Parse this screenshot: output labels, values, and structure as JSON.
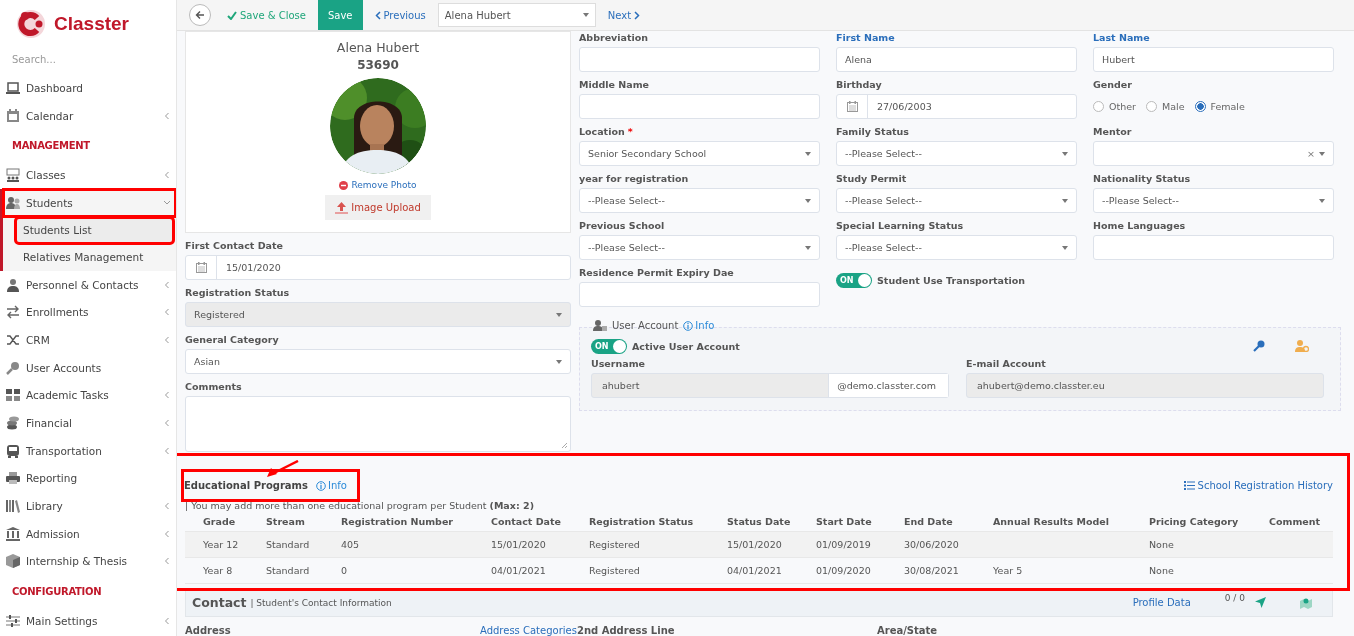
{
  "sidebar": {
    "logo": "Classter",
    "search": {
      "placeholder": "Search..."
    },
    "items": [
      {
        "kind": "link",
        "label": "Dashboard",
        "highlighted": false
      },
      {
        "kind": "menu",
        "label": "Calendar",
        "expanded": false,
        "highlighted": false
      },
      {
        "kind": "heading",
        "label": "MANAGEMENT"
      },
      {
        "kind": "menu",
        "label": "Classes",
        "expanded": false,
        "highlighted": false
      },
      {
        "kind": "menu",
        "label": "Students",
        "expanded": true,
        "highlighted": true,
        "children": [
          {
            "label": "Students List",
            "selected": true,
            "highlighted": true
          },
          {
            "label": "Relatives Management",
            "selected": false,
            "highlighted": false
          }
        ]
      },
      {
        "kind": "menu",
        "label": "Personnel & Contacts",
        "expanded": false,
        "highlighted": false
      },
      {
        "kind": "menu",
        "label": "Enrollments",
        "expanded": false,
        "highlighted": false
      },
      {
        "kind": "menu",
        "label": "CRM",
        "expanded": false,
        "highlighted": false
      },
      {
        "kind": "link",
        "label": "User Accounts",
        "highlighted": false
      },
      {
        "kind": "menu",
        "label": "Academic Tasks",
        "expanded": false,
        "highlighted": false
      },
      {
        "kind": "menu",
        "label": "Financial",
        "expanded": false,
        "highlighted": false
      },
      {
        "kind": "menu",
        "label": "Transportation",
        "expanded": false,
        "highlighted": false
      },
      {
        "kind": "link",
        "label": "Reporting",
        "highlighted": false
      },
      {
        "kind": "menu",
        "label": "Library",
        "expanded": false,
        "highlighted": false
      },
      {
        "kind": "menu",
        "label": "Admission",
        "expanded": false,
        "highlighted": false
      },
      {
        "kind": "menu",
        "label": "Internship & Thesis",
        "expanded": false,
        "highlighted": false
      },
      {
        "kind": "heading",
        "label": "CONFIGURATION"
      },
      {
        "kind": "menu",
        "label": "Main Settings",
        "expanded": false,
        "highlighted": false
      }
    ]
  },
  "toolbar": {
    "save_close": "Save & Close",
    "save": "Save",
    "previous": "Previous",
    "record": "Alena Hubert",
    "next": "Next"
  },
  "profile": {
    "name": "Alena Hubert",
    "id": "53690",
    "remove_photo": "Remove Photo",
    "upload": "Image Upload"
  },
  "left_fields": [
    {
      "kind": "date",
      "label": "First Contact Date",
      "value": "15/01/2020"
    },
    {
      "kind": "select",
      "label": "Registration Status",
      "value": "Registered",
      "disabled": true
    },
    {
      "kind": "select",
      "label": "General Category",
      "value": "Asian",
      "disabled": false
    },
    {
      "kind": "textarea",
      "label": "Comments"
    }
  ],
  "form_fields": [
    {
      "kind": "text",
      "label": "Abbreviation",
      "link": false
    },
    {
      "kind": "text",
      "label": "First Name",
      "value": "Alena",
      "link": true
    },
    {
      "kind": "text",
      "label": "Last Name",
      "value": "Hubert",
      "link": true
    },
    {
      "kind": "text",
      "label": "Middle Name",
      "link": false
    },
    {
      "kind": "date",
      "label": "Birthday",
      "value": "27/06/2003"
    },
    {
      "kind": "radio",
      "label": "Gender",
      "options": [
        {
          "label": "Other",
          "selected": false
        },
        {
          "label": "Male",
          "selected": false
        },
        {
          "label": "Female",
          "selected": true
        }
      ]
    },
    {
      "kind": "select",
      "label": "Location",
      "value": "Senior Secondary School",
      "required": true,
      "required_mark": "*"
    },
    {
      "kind": "select",
      "label": "Family Status",
      "value": "--Please Select--"
    },
    {
      "kind": "select",
      "label": "Mentor",
      "clear_text": "×"
    },
    {
      "kind": "select",
      "label": "year for registration",
      "value": "--Please Select--"
    },
    {
      "kind": "select",
      "label": "Study Permit",
      "value": "--Please Select--"
    },
    {
      "kind": "select",
      "label": "Nationality Status",
      "value": "--Please Select--"
    },
    {
      "kind": "select",
      "label": "Previous School",
      "value": "--Please Select--"
    },
    {
      "kind": "select",
      "label": "Special Learning Status",
      "value": "--Please Select--"
    },
    {
      "kind": "text",
      "label": "Home Languages",
      "link": false
    },
    {
      "kind": "text",
      "label": "Residence Permit Expiry Dae",
      "link": false
    },
    {
      "kind": "toggle",
      "label": "Student Use Transportation",
      "on": true,
      "switch_text": "ON"
    }
  ],
  "user_account": {
    "title": "User Account",
    "info": "Info",
    "active": {
      "label": "Active User Account",
      "on": true,
      "switch_text": "ON"
    },
    "username": {
      "label": "Username",
      "value": "ahubert",
      "suffix": "@demo.classter.com"
    },
    "email": {
      "label": "E-mail Account",
      "value": "ahubert@demo.classter.eu"
    }
  },
  "educational_programs": {
    "title": "Educational Programs",
    "info": "Info",
    "highlighted": true,
    "title_highlighted": true,
    "arrow": true,
    "history_link": "School Registration History",
    "note": "| You may add more than one educational program per Student **(Max: 2)**",
    "table": {
      "columns": [
        "Grade",
        "Stream",
        "Registration Number",
        "Contact Date",
        "Registration Status",
        "Status Date",
        "Start Date",
        "End Date",
        "Annual Results Model",
        "Pricing Category",
        "Comment"
      ],
      "rows": [
        [
          "Year 12",
          "Standard",
          "405",
          "15/01/2020",
          "Registered",
          "15/01/2020",
          "01/09/2019",
          "30/06/2020",
          "",
          "None",
          ""
        ],
        [
          "Year 8",
          "Standard",
          "0",
          "04/01/2021",
          "Registered",
          "04/01/2021",
          "01/09/2020",
          "30/08/2021",
          "Year 5",
          "None",
          ""
        ]
      ]
    }
  },
  "contact": {
    "title": "Contact",
    "subtitle": "| Student's Contact Information",
    "profile_link": "Profile Data",
    "count": "0 / 0",
    "address_label": "Address",
    "address_link": "Address Categories",
    "columns": [
      "2nd Address Line",
      "Area/State"
    ]
  }
}
